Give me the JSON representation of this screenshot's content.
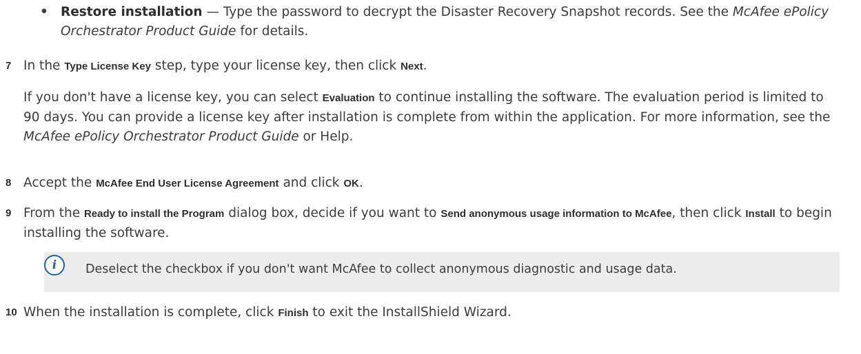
{
  "bullet": {
    "symbol": "•",
    "title": "Restore installation",
    "dash": " — Type the password to decrypt the Disaster Recovery Snapshot records. See the ",
    "guide": "McAfee ePolicy Orchestrator Product Guide",
    "tail": " for details."
  },
  "step7": {
    "number": "7",
    "t1": "In the ",
    "ui1": "Type License Key",
    "t2": " step, type your license key, then click ",
    "ui2": "Next",
    "t3": ".",
    "p1": "If you don't have a license key, you can select ",
    "p_ui": "Evaluation",
    "p2": " to continue installing the software. The evaluation period is limited to 90 days. You can provide a license key after installation is complete from within the application. For more information, see the ",
    "p_guide": "McAfee ePolicy Orchestrator Product Guide",
    "p3": " or Help."
  },
  "step8": {
    "number": "8",
    "t1": "Accept the ",
    "ui1": "McAfee End User License Agreement",
    "t2": " and click ",
    "ui2": "OK",
    "t3": "."
  },
  "step9": {
    "number": "9",
    "t1": "From the ",
    "ui1": "Ready to install the Program",
    "t2": " dialog box, decide if you want to ",
    "ui2": "Send anonymous usage information to McAfee",
    "t3": ", then click ",
    "ui3": "Install",
    "t4": " to begin installing the software."
  },
  "note": {
    "icon": "info-icon",
    "text": "Deselect the checkbox if you don't want McAfee to collect anonymous diagnostic and usage data."
  },
  "step10": {
    "number": "10",
    "t1": "When the installation is complete, click ",
    "ui1": "Finish",
    "t2": " to exit the InstallShield Wizard."
  },
  "colors": {
    "note_bg": "#ededed",
    "info_icon": "#1f62a6",
    "text": "#3c3c3c"
  }
}
